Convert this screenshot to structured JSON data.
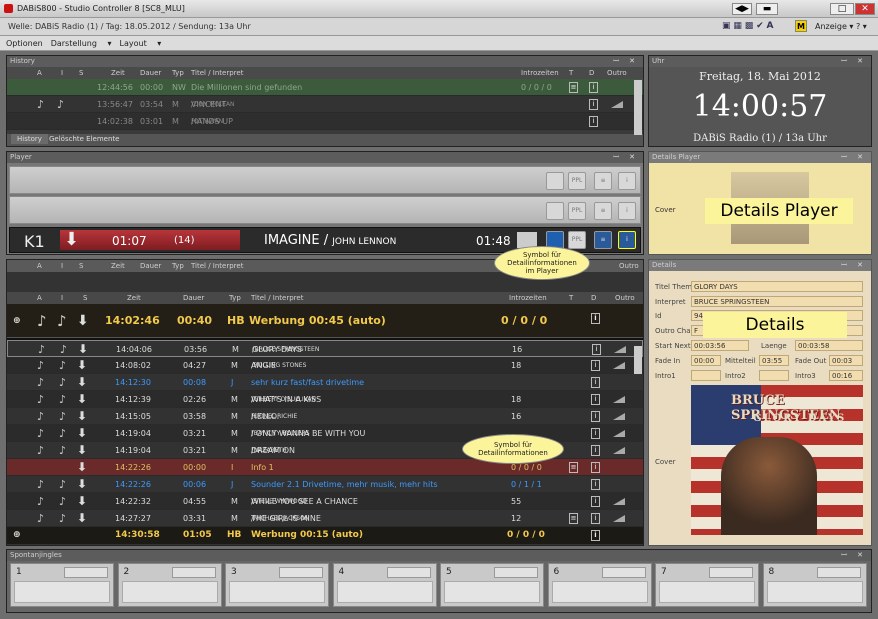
{
  "window": {
    "title": "DABiS800 - Studio Controller 8 [SC8_MLU]"
  },
  "infobar": {
    "text": "Welle: DABiS Radio (1) / Tag: 18.05.2012 / Sendung: 13a Uhr",
    "anzeige": "Anzeige",
    "help": "?"
  },
  "menu": {
    "optionen": "Optionen",
    "darstellung": "Darstellung",
    "layout": "Layout"
  },
  "history": {
    "title": "History",
    "cols": {
      "a": "A",
      "i": "I",
      "s": "S",
      "zeit": "Zeit",
      "dauer": "Dauer",
      "typ": "Typ",
      "titel": "Titel / Interpret",
      "intro": "Introzeiten",
      "t": "T",
      "d": "D",
      "outro": "Outro"
    },
    "rows": [
      {
        "zeit": "12:44:56",
        "dauer": "00:00",
        "typ": "NW",
        "titel": "Die Millionen sind gefunden",
        "intro": "0 / 0 / 0"
      },
      {
        "zeit": "13:56:47",
        "dauer": "03:54",
        "typ": "M",
        "titel": "VINCENT",
        "artist": "DON MCLEAN",
        "intro": ""
      },
      {
        "zeit": "14:02:38",
        "dauer": "03:01",
        "typ": "M",
        "titel": "HANDS UP",
        "artist": "OTTAWAN",
        "intro": ""
      }
    ],
    "tabs": [
      "History",
      "Gelöschte Elemente"
    ]
  },
  "uhr": {
    "title": "Uhr",
    "date": "Freitag, 18. Mai 2012",
    "time": "14:00:57",
    "station": "DABiS Radio (1) / 13a Uhr"
  },
  "player": {
    "title": "Player",
    "k1": {
      "label": "K1",
      "elapsed": "01:07",
      "count": "(14)",
      "title": "IMAGINE",
      "artist": "JOHN LENNON",
      "remaining": "01:48"
    },
    "ppl": "PPL",
    "callout": "Symbol für Detailinformationen im Player"
  },
  "details_player": {
    "title": "Details Player",
    "cover_label": "Cover",
    "overlay": "Details Player"
  },
  "playlist": {
    "cols": {
      "a": "A",
      "i": "I",
      "s": "S",
      "zeit": "Zeit",
      "dauer": "Dauer",
      "typ": "Typ",
      "titel": "Titel / Interpret",
      "intro": "Introzeiten",
      "t": "T",
      "d": "D",
      "outro": "Outro"
    },
    "current": {
      "zeit": "14:02:46",
      "dauer": "00:40",
      "typ": "HB",
      "titel": "Werbung 00:45 (auto)",
      "intro": "0 / 0 / 0"
    },
    "rows": [
      {
        "zeit": "14:04:06",
        "dauer": "03:56",
        "typ": "M",
        "titel": "GLORY DAYS",
        "artist": "BRUCE SPRINGSTEEN",
        "intro": "16",
        "kind": "music"
      },
      {
        "zeit": "14:08:02",
        "dauer": "04:27",
        "typ": "M",
        "titel": "ANGIE",
        "artist": "ROLLING STONES",
        "intro": "18",
        "kind": "music"
      },
      {
        "zeit": "14:12:30",
        "dauer": "00:08",
        "typ": "J",
        "titel": "sehr kurz fast/fast drivetime",
        "artist": "",
        "intro": "",
        "kind": "jingle"
      },
      {
        "zeit": "14:12:39",
        "dauer": "02:26",
        "typ": "M",
        "titel": "WHAT'S IN A KISS",
        "artist": "GILBERT O'SULLIVAN",
        "intro": "18",
        "kind": "music"
      },
      {
        "zeit": "14:15:05",
        "dauer": "03:58",
        "typ": "M",
        "titel": "HELLO.",
        "artist": "LIONEL RICHIE",
        "intro": "16",
        "kind": "music"
      },
      {
        "zeit": "14:19:04",
        "dauer": "03:21",
        "typ": "M",
        "titel": "I ONLY WANNA BE WITH YOU",
        "artist": "BAY CITY ROLLERS",
        "intro": "",
        "kind": "music"
      },
      {
        "zeit": "14:19:04",
        "dauer": "03:21",
        "typ": "M",
        "titel": "DREAM ON",
        "artist": "NAZARETH",
        "intro": "",
        "kind": "music"
      },
      {
        "zeit": "14:22:26",
        "dauer": "00:00",
        "typ": "I",
        "titel": "Info 1",
        "artist": "",
        "intro": "0 / 0 / 0",
        "kind": "info"
      },
      {
        "zeit": "14:22:26",
        "dauer": "00:06",
        "typ": "J",
        "titel": "Sounder 2.1 Drivetime, mehr musik, mehr hits",
        "artist": "",
        "intro": "0 / 1 / 1",
        "kind": "jingle"
      },
      {
        "zeit": "14:22:32",
        "dauer": "04:55",
        "typ": "M",
        "titel": "WHILE YOU SEE A CHANCE",
        "artist": "STEVE WINWOOD",
        "intro": "55",
        "kind": "music"
      },
      {
        "zeit": "14:27:27",
        "dauer": "03:31",
        "typ": "M",
        "titel": "THE GIRL IS MINE",
        "artist": "MICHAEL JACKSON",
        "intro": "12",
        "kind": "music"
      }
    ],
    "next": {
      "zeit": "14:30:58",
      "dauer": "01:05",
      "typ": "HB",
      "titel": "Werbung 00:15 (auto)",
      "intro": "0 / 0 / 0"
    },
    "callout": "Symbol für Detailinformationen"
  },
  "details": {
    "title": "Details",
    "overlay": "Details",
    "fields": {
      "titel_thema": {
        "label": "Titel Thema",
        "value": "GLORY DAYS"
      },
      "interpret": {
        "label": "Interpret",
        "value": "BRUCE SPRINGSTEEN"
      },
      "id": {
        "label": "Id",
        "value": "94"
      },
      "outro_char": {
        "label": "Outro Char",
        "value": "F"
      },
      "start_next": {
        "label": "Start Next",
        "value": "00:03:56"
      },
      "laenge": {
        "label": "Laenge",
        "value": "00:03:58"
      },
      "fade_in": {
        "label": "Fade In",
        "value": "00:00"
      },
      "mittelteil": {
        "label": "Mittelteil",
        "value": "03:55"
      },
      "fade_out": {
        "label": "Fade Out",
        "value": "00:03"
      },
      "intro1": {
        "label": "Intro1",
        "value": ""
      },
      "intro2": {
        "label": "Intro2",
        "value": ""
      },
      "intro3": {
        "label": "Intro3",
        "value": "00:16"
      }
    },
    "cover_label": "Cover",
    "cover_art": {
      "artist": "BRUCE SPRINGSTEEN",
      "title": "GLORY DAYS"
    }
  },
  "spontan": {
    "title": "Spontanjingles",
    "slots": [
      "1",
      "2",
      "3",
      "4",
      "5",
      "6",
      "7",
      "8"
    ]
  }
}
